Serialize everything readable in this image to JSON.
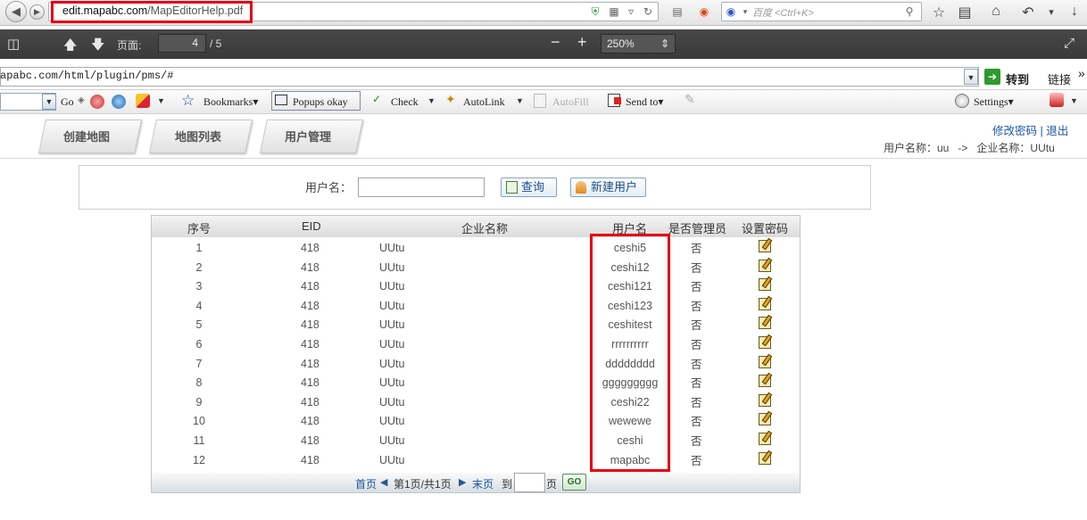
{
  "browser": {
    "url_host": "edit.mapabc.com",
    "url_path": "/MapEditorHelp.pdf",
    "search_placeholder": "百度 <Ctrl+K>"
  },
  "pdf_toolbar": {
    "page_label": "页面:",
    "page_current": "4",
    "page_total": "/ 5",
    "zoom": "250%"
  },
  "address_strip": {
    "url": "apabc.com/html/plugin/pms/#",
    "goto": "转到",
    "links": "链接",
    "more": "»"
  },
  "google_toolbar": {
    "go": "Go",
    "bookmarks": "Bookmarks▾",
    "popups": "Popups okay",
    "check": "Check",
    "autolink": "AutoLink",
    "autofill": "AutoFill",
    "sendto": "Send to▾",
    "settings": "Settings▾"
  },
  "nav": {
    "tabs": [
      "创建地图",
      "地图列表",
      "用户管理"
    ]
  },
  "header": {
    "change_password": "修改密码",
    "divider": "|",
    "logout": "退出",
    "user_label": "用户名称：uu",
    "arrow": "->",
    "company_label": "企业名称：UUtu"
  },
  "search": {
    "username_label": "用户名：",
    "query_button": "查询",
    "new_user_button": "新建用户"
  },
  "table": {
    "headers": [
      "序号",
      "EID",
      "企业名称",
      "用户名",
      "是否管理员",
      "设置密码"
    ],
    "rows": [
      {
        "no": "1",
        "eid": "418",
        "company": "UUtu",
        "user": "ceshi5",
        "admin": "否"
      },
      {
        "no": "2",
        "eid": "418",
        "company": "UUtu",
        "user": "ceshi12",
        "admin": "否"
      },
      {
        "no": "3",
        "eid": "418",
        "company": "UUtu",
        "user": "ceshi121",
        "admin": "否"
      },
      {
        "no": "4",
        "eid": "418",
        "company": "UUtu",
        "user": "ceshi123",
        "admin": "否"
      },
      {
        "no": "5",
        "eid": "418",
        "company": "UUtu",
        "user": "ceshitest",
        "admin": "否"
      },
      {
        "no": "6",
        "eid": "418",
        "company": "UUtu",
        "user": "rrrrrrrrrr",
        "admin": "否"
      },
      {
        "no": "7",
        "eid": "418",
        "company": "UUtu",
        "user": "dddddddd",
        "admin": "否"
      },
      {
        "no": "8",
        "eid": "418",
        "company": "UUtu",
        "user": "ggggggggg",
        "admin": "否"
      },
      {
        "no": "9",
        "eid": "418",
        "company": "UUtu",
        "user": "ceshi22",
        "admin": "否"
      },
      {
        "no": "10",
        "eid": "418",
        "company": "UUtu",
        "user": "wewewe",
        "admin": "否"
      },
      {
        "no": "11",
        "eid": "418",
        "company": "UUtu",
        "user": "ceshi",
        "admin": "否"
      },
      {
        "no": "12",
        "eid": "418",
        "company": "UUtu",
        "user": "mapabc",
        "admin": "否"
      }
    ]
  },
  "pager": {
    "first": "首页",
    "info": "第1页/共1页",
    "last": "末页",
    "to": "到",
    "page": "页",
    "go": "GO"
  },
  "colors": {
    "highlight": "#e60012",
    "link": "#1a56a0"
  }
}
